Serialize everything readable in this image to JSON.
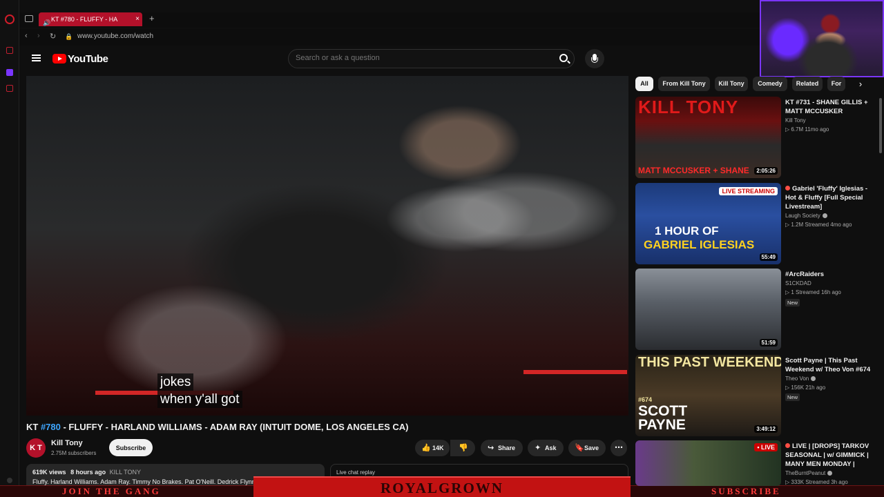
{
  "browser": {
    "tab_title": "KT #780 - FLUFFY - HA",
    "tab_close": "×",
    "tab_add": "+",
    "url": "www.youtube.com/watch",
    "back": "‹",
    "forward": "›",
    "reload": "↻"
  },
  "header": {
    "logo_text": "YouTube",
    "search_placeholder": "Search or ask a question"
  },
  "video": {
    "captions": [
      "jokes",
      "when y'all got"
    ],
    "title_prefix": "KT ",
    "title_hash": "#780",
    "title_rest": " - FLUFFY - HARLAND WILLIAMS - ADAM RAY (INTUIT DOME, LOS ANGELES CA)"
  },
  "channel": {
    "avatar_text": "K T",
    "name": "Kill Tony",
    "subscribers": "2.75M subscribers",
    "subscribe_label": "Subscribe"
  },
  "actions": {
    "likes": "14K",
    "share": "Share",
    "ask": "Ask",
    "save": "Save",
    "more": "⋯"
  },
  "description": {
    "views": "619K views",
    "age": "8 hours ago",
    "tag": "KILL TONY",
    "text": "Fluffy. Harland Williams. Adam Ray. Timmy No Brakes. Pat O'Neill. Dedrick Flynn"
  },
  "chat": {
    "label": "Live chat replay"
  },
  "overlay": {
    "left_text": "JOIN THE GANG",
    "center_text": "ROYALGROWN",
    "right_text": "SUBSCRIBE"
  },
  "chips": [
    {
      "label": "All",
      "active": true
    },
    {
      "label": "From Kill Tony",
      "active": false
    },
    {
      "label": "Kill Tony",
      "active": false
    },
    {
      "label": "Comedy",
      "active": false
    },
    {
      "label": "Related",
      "active": false
    },
    {
      "label": "For",
      "active": false
    }
  ],
  "chip_next": "›",
  "recommendations": [
    {
      "thumb_text": "KILL TONY",
      "thumb_sub": "MATT MCCUSKER + SHANE",
      "duration": "2:05:26",
      "title": "KT #731 - SHANE GILLIS + MATT MCCUSKER",
      "channel": "Kill Tony",
      "stats": "▷ 6.7M  11mo ago"
    },
    {
      "thumb_text": "1 HOUR OF",
      "thumb_sub": "GABRIEL IGLESIAS",
      "thumb_badge": "LIVE STREAMING",
      "duration": "55:49",
      "title": "Gabriel 'Fluffy' Iglesias - Hot & Fluffy [Full Special Livestream]",
      "channel": "Laugh Society",
      "stats": "▷ 1.2M  Streamed 4mo ago"
    },
    {
      "duration": "51:59",
      "title": "#ArcRaiders",
      "channel": "S1CKDAD",
      "stats": "▷ 1  Streamed 16h ago",
      "new": "New"
    },
    {
      "thumb_text": "THIS PAST WEEKEND",
      "thumb_sub": "SCOTT PAYNE",
      "thumb_num": "#674",
      "duration": "3:49:12",
      "title": "Scott Payne | This Past Weekend w/ Theo Von #674",
      "channel": "Theo Von",
      "stats": "▷ 156K  21h ago",
      "new": "New"
    },
    {
      "live": "• LIVE",
      "title": "LIVE | [DROPS] TARKOV SEASONAL | w/ GIMMICK | MANY MEN MONDAY | MA...",
      "channel": "TheBurntPeanut",
      "stats": "▷ 333K  Streamed 3h ago"
    }
  ],
  "colors": {
    "accent_red": "#ff0000",
    "tab_red": "#b3112a",
    "link_blue": "#3ea6ff",
    "banner_red": "#c21212",
    "webcam_purple": "#7b35ff"
  }
}
